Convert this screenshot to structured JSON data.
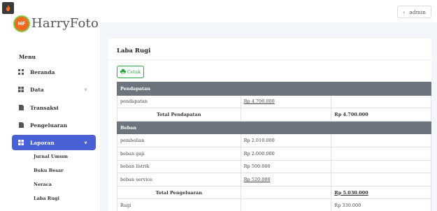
{
  "header": {
    "app_icon": "app-flame-icon",
    "user_menu": {
      "icon": "chevron-left-icon",
      "label": "admin"
    }
  },
  "logo": {
    "badge": "HF",
    "text": "HarryFoto"
  },
  "sidebar": {
    "menu_title": "Menu",
    "items": [
      {
        "label": "Beranda",
        "icon": "grid-icon"
      },
      {
        "label": "Data",
        "icon": "grid-icon"
      },
      {
        "label": "Transaksi",
        "icon": "document-icon"
      },
      {
        "label": "Pengeluaran",
        "icon": "document-icon"
      },
      {
        "label": "Laporan",
        "icon": "grid-icon"
      }
    ],
    "sub_items": [
      {
        "label": "Jurnal Umum"
      },
      {
        "label": "Buku Besar"
      },
      {
        "label": "Neraca"
      },
      {
        "label": "Laba Rugi"
      }
    ],
    "active_color": "#4a61d6"
  },
  "main": {
    "title": "Laba Rugi",
    "print_button": {
      "label": "Cetak",
      "icon": "printer-icon",
      "color": "#28a745"
    },
    "table": {
      "pendapatan_header": "Pendapatan",
      "pendapatan_rows": [
        {
          "name": "pendapatan",
          "amount": "Rp 4.700.000"
        }
      ],
      "total_pendapatan": {
        "label": "Total Pendapatan",
        "amount": "Rp 4.700.000"
      },
      "beban_header": "Beban",
      "beban_rows": [
        {
          "name": "pembelian",
          "amount": "Rp 2.010.000"
        },
        {
          "name": "beban gaji",
          "amount": "Rp 2.000.000"
        },
        {
          "name": "beban listrik",
          "amount": "Rp 500.000"
        },
        {
          "name": "beban service",
          "amount": "Rp 520.000"
        }
      ],
      "total_pengeluaran": {
        "label": "Total Pengeluaran",
        "amount": "Rp 5.030.000"
      },
      "rugi": {
        "label": "Rugi",
        "amount": "Rp 330.000"
      },
      "header_color": "#6c757d"
    }
  }
}
